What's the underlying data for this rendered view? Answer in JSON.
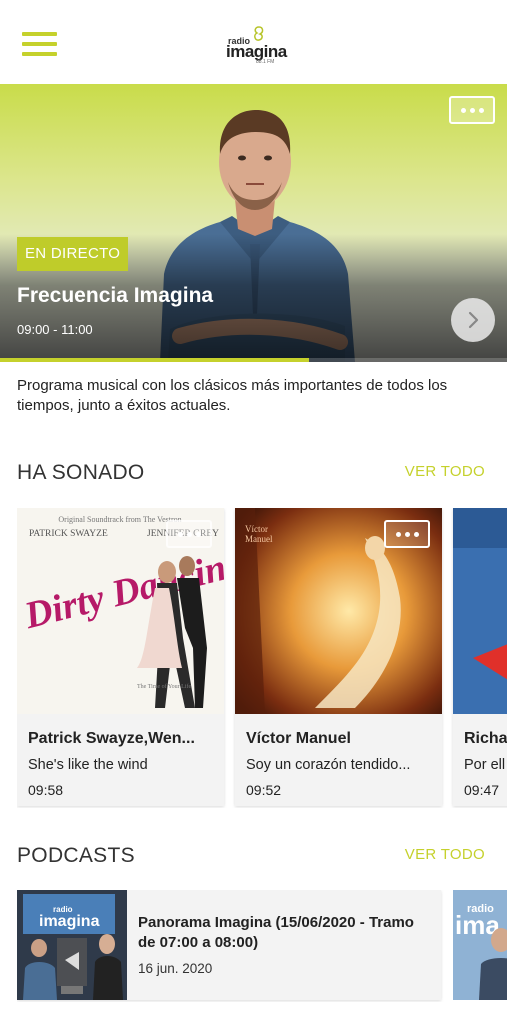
{
  "header": {
    "logo_small": "radio",
    "logo_main": "imagina",
    "logo_freq": "88.1 FM"
  },
  "hero": {
    "badge": "EN DIRECTO",
    "title": "Frecuencia Imagina",
    "time": "09:00 - 11:00",
    "progress": 0.61
  },
  "description": "Programa musical con los clásicos más importantes de todos los tiempos, junto a éxitos actuales.",
  "recently_played": {
    "heading": "HA SONADO",
    "see_all": "VER TODO",
    "items": [
      {
        "artist": "Patrick Swayze,Wen...",
        "song": "She's like the wind",
        "time": "09:58",
        "cover_top": "PATRICK SWAYZE",
        "cover_top2": "JENNIFER GREY",
        "cover_title": "Dirty Dancing"
      },
      {
        "artist": "Víctor Manuel",
        "song": "Soy un corazón tendido...",
        "time": "09:52"
      },
      {
        "artist": "Richa",
        "song": "Por ell",
        "time": "09:47"
      }
    ]
  },
  "podcasts": {
    "heading": "PODCASTS",
    "see_all": "VER TODO",
    "items": [
      {
        "title": "Panorama Imagina (15/06/2020 - Tramo de 07:00 a 08:00)",
        "date": "16 jun. 2020",
        "thumb_small": "radio",
        "thumb_main": "imagina"
      },
      {
        "thumb_small": "radio",
        "thumb_main": "ima"
      }
    ]
  },
  "colors": {
    "accent": "#c5d12c",
    "badge": "#bfcc2a"
  }
}
